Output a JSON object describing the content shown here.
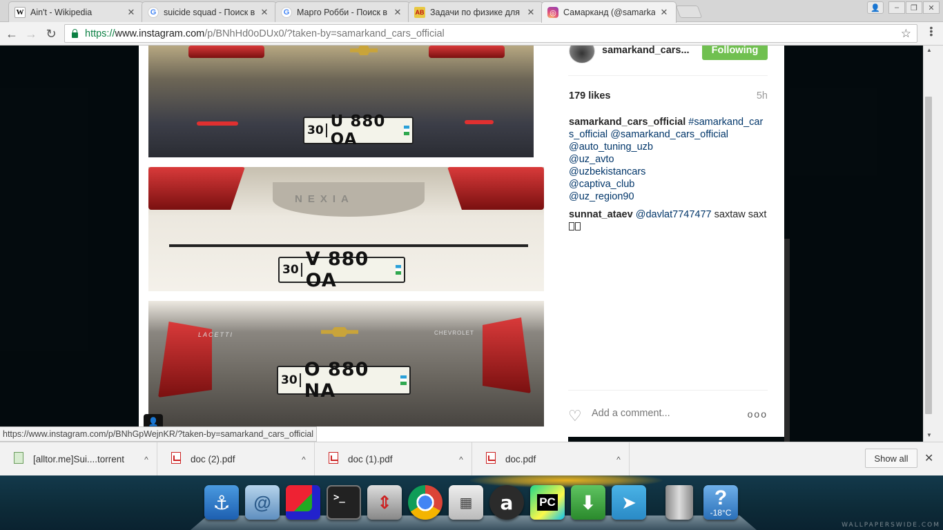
{
  "browser": {
    "tabs": [
      {
        "title": "Ain't - Wikipedia",
        "favicon": "wikipedia-icon",
        "active": false
      },
      {
        "title": "suicide squad - Поиск в",
        "favicon": "google-icon",
        "active": false
      },
      {
        "title": "Марго Робби - Поиск в",
        "favicon": "google-icon",
        "active": false
      },
      {
        "title": "Задачи по физике для",
        "favicon": "ab-icon",
        "active": false
      },
      {
        "title": "Самарканд (@samarka",
        "favicon": "instagram-icon",
        "active": true
      }
    ],
    "url": {
      "scheme": "https://",
      "host": "www.instagram.com",
      "path": "/p/BNhHd0oDUx0/?taken-by=samarkand_cars_official"
    }
  },
  "post": {
    "plates": [
      {
        "region": "30",
        "number": "U 880 OA"
      },
      {
        "region": "30",
        "number": "V 880 OA"
      },
      {
        "region": "30",
        "number": "O 880 NA"
      }
    ],
    "car_badges": [
      "NEXIA",
      "LACETTI",
      "CHEVROLET"
    ],
    "owner": "samarkand_cars...",
    "follow_label": "Following",
    "likes": "179 likes",
    "time": "5h",
    "caption": {
      "user": "samarkand_cars_official",
      "lines": [
        "#samarkand_cars_official",
        "@samarkand_cars_official",
        "@auto_tuning_uzb",
        "@uz_avto",
        "@uzbekistancars",
        "@captiva_club",
        "@uz_region90"
      ]
    },
    "comment": {
      "user": "sunnat_ataev",
      "mention": "@davlat7747477",
      "text": "saxtaw saxt"
    },
    "add_comment_placeholder": "Add a comment...",
    "more_label": "ooo"
  },
  "status_url": "https://www.instagram.com/p/BNhGpWejnKR/?taken-by=samarkand_cars_official",
  "downloads": [
    {
      "name": "[alltor.me]Sui....torrent",
      "type": "torrent"
    },
    {
      "name": "doc (2).pdf",
      "type": "pdf"
    },
    {
      "name": "doc (1).pdf",
      "type": "pdf"
    },
    {
      "name": "doc.pdf",
      "type": "pdf"
    }
  ],
  "show_all_label": "Show all",
  "dock": {
    "weather_temp": "-18°C",
    "items": [
      "anchor-icon",
      "swirl-icon",
      "windows-icon",
      "terminal-icon",
      "settings-icon",
      "chrome-icon",
      "calculator-icon",
      "a-icon",
      "pycharm-icon",
      "download-icon",
      "telegram-icon",
      "trash-icon",
      "help-icon"
    ]
  },
  "wallpaper_mark": "WALLPAPERSWIDE.COM",
  "colors": {
    "follow_green": "#70c050",
    "link_blue": "#003569",
    "url_green": "#0b8043"
  }
}
